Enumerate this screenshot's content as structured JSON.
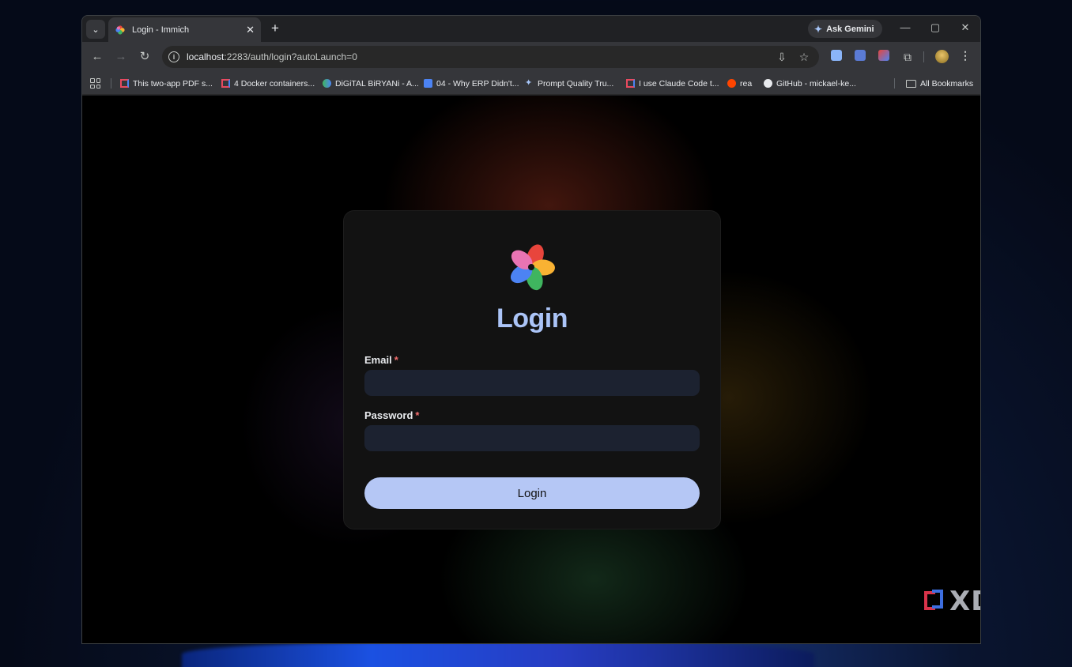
{
  "browser": {
    "tab": {
      "title": "Login - Immich"
    },
    "gemini_label": "Ask Gemini",
    "url": {
      "host": "localhost",
      "path": ":2283/auth/login?autoLaunch=0"
    },
    "bookmarks": [
      "This two-app PDF s...",
      "4 Docker containers...",
      "DiGiTAL BiRYANi - A...",
      "04 - Why ERP Didn't...",
      "Prompt Quality Tru...",
      "I use Claude Code t...",
      "rea",
      "GitHub - mickael-ke..."
    ],
    "all_bookmarks": "All Bookmarks"
  },
  "login": {
    "title": "Login",
    "email_label": "Email",
    "password_label": "Password",
    "required_mark": "*",
    "email_value": "",
    "password_value": "",
    "button_label": "Login"
  },
  "watermark": "XDA",
  "colors": {
    "accent": "#abc4f7",
    "button_bg": "#b5c7f5",
    "input_bg": "#1c2230",
    "card_bg": "#121212",
    "required": "#f26d6d"
  }
}
